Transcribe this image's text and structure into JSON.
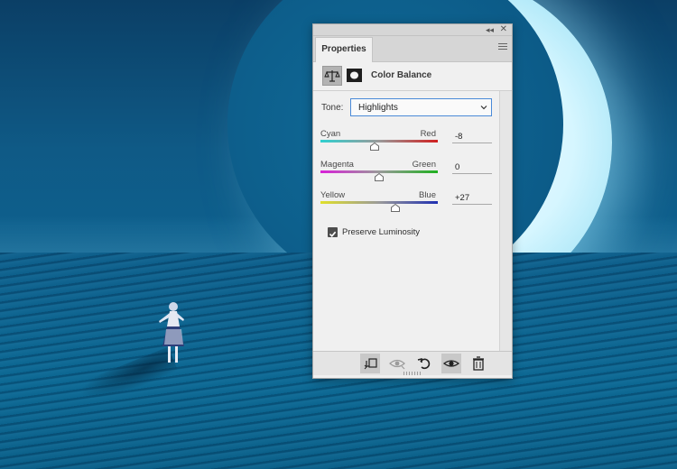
{
  "panel": {
    "collapse_glyph": "◂◂",
    "close_glyph": "✕",
    "tab_label": "Properties",
    "adjustment_title": "Color Balance"
  },
  "tone": {
    "label": "Tone:",
    "selected": "Highlights"
  },
  "sliders": [
    {
      "left_label": "Cyan",
      "right_label": "Red",
      "value": "-8",
      "position": -8,
      "left_color": "#2fd0d0",
      "right_color": "#d01f1f"
    },
    {
      "left_label": "Magenta",
      "right_label": "Green",
      "value": "0",
      "position": 0,
      "left_color": "#d81fd8",
      "right_color": "#1fb01f"
    },
    {
      "left_label": "Yellow",
      "right_label": "Blue",
      "value": "+27",
      "position": 27,
      "left_color": "#e0e02a",
      "right_color": "#1f2fb0"
    }
  ],
  "preserve_luminosity": {
    "label": "Preserve Luminosity",
    "checked": true
  },
  "footer_icons": [
    "clip-to-layer-icon",
    "view-previous-state-icon",
    "reset-icon",
    "visibility-eye-icon",
    "trash-icon"
  ]
}
